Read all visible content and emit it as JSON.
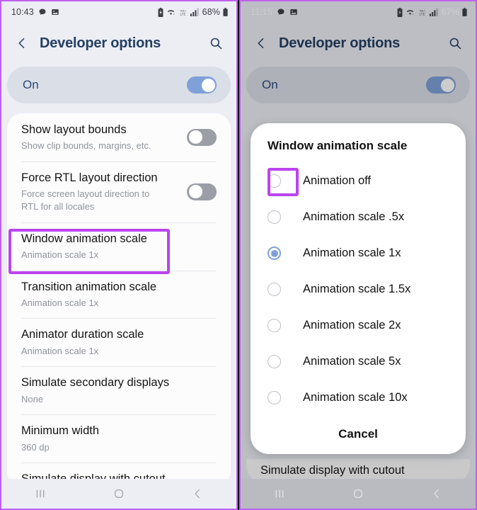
{
  "accent": {
    "highlight_purple": "#bb44ee",
    "toggle_blue": "#7fa0d8",
    "title_blue": "#253f62",
    "frame_purple": "#c060f0"
  },
  "left_phone": {
    "status_bar": {
      "time": "10:43",
      "battery_percent": "68%",
      "icons_left": [
        "chat-bubble-icon",
        "photos-icon"
      ],
      "icons_right": [
        "battery-saver-icon",
        "wifi-icon",
        "volte-icon",
        "signal-bars-icon",
        "battery-icon"
      ]
    },
    "app_bar": {
      "back_icon": "chevron-left-icon",
      "title": "Developer options",
      "search_icon": "search-icon"
    },
    "master_switch": {
      "label": "On",
      "state": "on"
    },
    "rows": [
      {
        "title": "Show layout bounds",
        "subtitle": "Show clip bounds, margins, etc.",
        "toggle": "off",
        "highlighted": false
      },
      {
        "title": "Force RTL layout direction",
        "subtitle": "Force screen layout direction to RTL for all locales",
        "toggle": "off",
        "highlighted": false
      },
      {
        "title": "Window animation scale",
        "subtitle": "Animation scale 1x",
        "toggle": null,
        "highlighted": true
      },
      {
        "title": "Transition animation scale",
        "subtitle": "Animation scale 1x",
        "toggle": null,
        "highlighted": false
      },
      {
        "title": "Animator duration scale",
        "subtitle": "Animation scale 1x",
        "toggle": null,
        "highlighted": false
      },
      {
        "title": "Simulate secondary displays",
        "subtitle": "None",
        "toggle": null,
        "highlighted": false
      },
      {
        "title": "Minimum width",
        "subtitle": "360 dp",
        "toggle": null,
        "highlighted": false
      }
    ],
    "clipped_row_title": "Simulate display with cutout",
    "nav_bar": {
      "recents_icon": "recents-icon",
      "home_icon": "home-icon",
      "back_icon": "chevron-left-icon"
    }
  },
  "right_phone": {
    "status_bar": {
      "time": "11:15",
      "battery_percent": "67%",
      "icons_left": [
        "chat-bubble-icon",
        "photos-icon"
      ],
      "icons_right": [
        "battery-saver-icon",
        "wifi-icon",
        "volte-icon",
        "signal-bars-icon",
        "battery-icon"
      ]
    },
    "app_bar": {
      "back_icon": "chevron-left-icon",
      "title": "Developer options",
      "search_icon": "search-icon"
    },
    "master_switch": {
      "label": "On",
      "state": "on"
    },
    "dialog": {
      "title": "Window animation scale",
      "options": [
        {
          "label": "Animation off",
          "selected": false,
          "highlighted": true
        },
        {
          "label": "Animation scale .5x",
          "selected": false,
          "highlighted": false
        },
        {
          "label": "Animation scale 1x",
          "selected": true,
          "highlighted": false
        },
        {
          "label": "Animation scale 1.5x",
          "selected": false,
          "highlighted": false
        },
        {
          "label": "Animation scale 2x",
          "selected": false,
          "highlighted": false
        },
        {
          "label": "Animation scale 5x",
          "selected": false,
          "highlighted": false
        },
        {
          "label": "Animation scale 10x",
          "selected": false,
          "highlighted": false
        }
      ],
      "cancel_label": "Cancel"
    },
    "behind_row_title": "Simulate display with cutout",
    "nav_bar": {
      "recents_icon": "recents-icon",
      "home_icon": "home-icon",
      "back_icon": "chevron-left-icon"
    }
  }
}
